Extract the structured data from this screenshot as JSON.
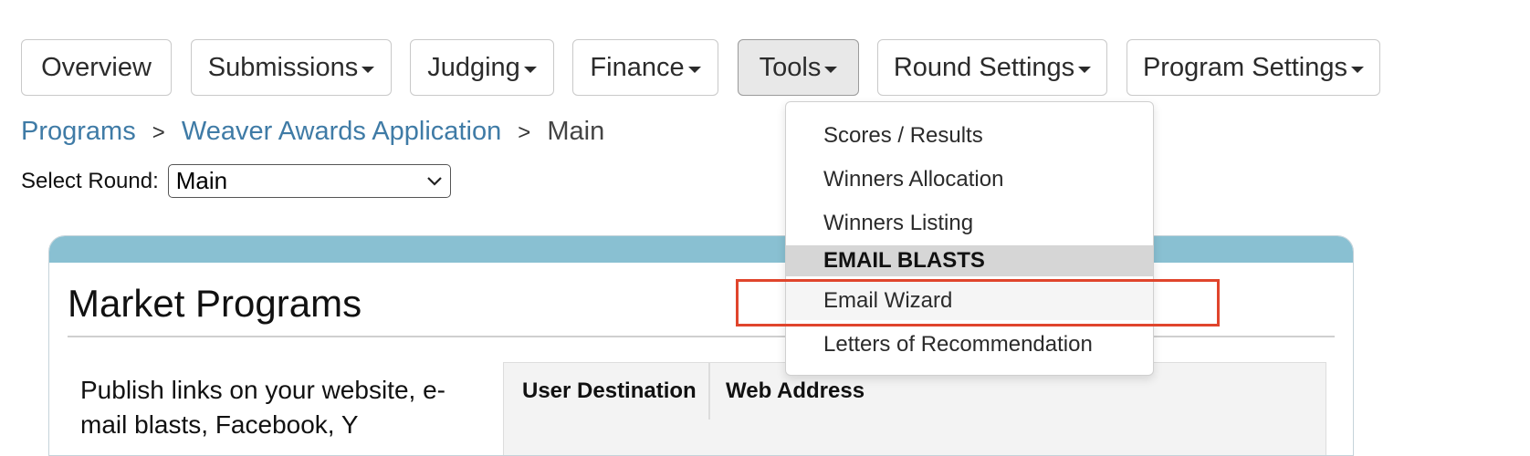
{
  "nav": {
    "items": [
      {
        "label": "Overview",
        "caret": false,
        "active": false
      },
      {
        "label": "Submissions",
        "caret": true,
        "active": false
      },
      {
        "label": "Judging",
        "caret": true,
        "active": false
      },
      {
        "label": "Finance",
        "caret": true,
        "active": false
      },
      {
        "label": "Tools",
        "caret": true,
        "active": true
      },
      {
        "label": "Round Settings",
        "caret": true,
        "active": false
      },
      {
        "label": "Program Settings",
        "caret": true,
        "active": false
      }
    ]
  },
  "breadcrumb": {
    "programs": "Programs",
    "sep1": ">",
    "application": "Weaver Awards Application",
    "sep2": ">",
    "current": "Main"
  },
  "round": {
    "label": "Select Round:",
    "selected": "Main"
  },
  "panel": {
    "title": "Market Programs",
    "text": "Publish links on your website, e-mail blasts, Facebook, Y",
    "table": {
      "headers": [
        "User Destination",
        "Web Address"
      ]
    }
  },
  "tools_menu": {
    "items": [
      {
        "label": "Scores / Results",
        "kind": "item"
      },
      {
        "label": "Winners Allocation",
        "kind": "item"
      },
      {
        "label": "Winners Listing",
        "kind": "item"
      },
      {
        "label": "EMAIL BLASTS",
        "kind": "header"
      },
      {
        "label": "Email Wizard",
        "kind": "item",
        "highlighted": true
      },
      {
        "label": "Letters of Recommendation",
        "kind": "item"
      }
    ]
  },
  "colors": {
    "link": "#3f7ba6",
    "panel_bar": "#89c0d2",
    "highlight_box": "#e0452c"
  }
}
